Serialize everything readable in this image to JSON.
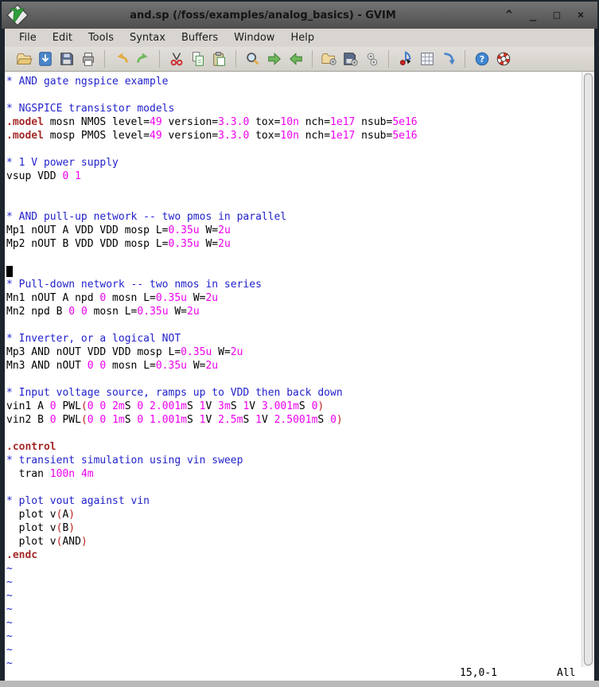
{
  "window": {
    "title": "and.sp (/foss/examples/analog_basics) - GVIM",
    "controls": [
      {
        "name": "shade",
        "glyph": "^"
      },
      {
        "name": "minimize",
        "glyph": "_"
      },
      {
        "name": "maximize",
        "glyph": "□"
      },
      {
        "name": "close",
        "glyph": "×"
      }
    ]
  },
  "menubar": {
    "items": [
      "File",
      "Edit",
      "Tools",
      "Syntax",
      "Buffers",
      "Window",
      "Help"
    ]
  },
  "toolbar": {
    "groups": [
      [
        "open-file",
        "save-file",
        "save-all",
        "print"
      ],
      [
        "undo",
        "redo"
      ],
      [
        "cut",
        "copy",
        "paste"
      ],
      [
        "find-replace",
        "find-next",
        "find-prev"
      ],
      [
        "load-session",
        "save-session",
        "run-script"
      ],
      [
        "make",
        "build-tags",
        "tag-jump"
      ],
      [
        "help",
        "find-in-help"
      ]
    ]
  },
  "colors": {
    "comment": "#2222cc",
    "statement": "#a52a2a",
    "number": "#ee00ee",
    "paren": "#c22121",
    "background": "#ffffff",
    "frame": "#1c242c"
  },
  "editor": {
    "cursor_line": 15,
    "tilde_count": 8,
    "ruler": "15,0-1",
    "scroll_pos": "All",
    "lines": [
      [
        [
          "c",
          "* AND gate ngspice example"
        ]
      ],
      [],
      [
        [
          "c",
          "* NGSPICE transistor models"
        ]
      ],
      [
        [
          "k",
          ".model"
        ],
        [
          "t",
          " mosn NMOS level="
        ],
        [
          "n",
          "49"
        ],
        [
          "t",
          " version="
        ],
        [
          "n",
          "3.3.0"
        ],
        [
          "t",
          " tox="
        ],
        [
          "n",
          "10n"
        ],
        [
          "t",
          " nch="
        ],
        [
          "n",
          "1e17"
        ],
        [
          "t",
          " nsub="
        ],
        [
          "n",
          "5e16"
        ]
      ],
      [
        [
          "k",
          ".model"
        ],
        [
          "t",
          " mosp PMOS level="
        ],
        [
          "n",
          "49"
        ],
        [
          "t",
          " version="
        ],
        [
          "n",
          "3.3.0"
        ],
        [
          "t",
          " tox="
        ],
        [
          "n",
          "10n"
        ],
        [
          "t",
          " nch="
        ],
        [
          "n",
          "1e17"
        ],
        [
          "t",
          " nsub="
        ],
        [
          "n",
          "5e16"
        ]
      ],
      [],
      [
        [
          "c",
          "* 1 V power supply"
        ]
      ],
      [
        [
          "t",
          "vsup VDD "
        ],
        [
          "n",
          "0"
        ],
        [
          "t",
          " "
        ],
        [
          "n",
          "1"
        ]
      ],
      [],
      [],
      [
        [
          "c",
          "* AND pull-up network -- two pmos in parallel"
        ]
      ],
      [
        [
          "t",
          "Mp1 nOUT A VDD VDD mosp L="
        ],
        [
          "n",
          "0.35u"
        ],
        [
          "t",
          " W="
        ],
        [
          "n",
          "2u"
        ]
      ],
      [
        [
          "t",
          "Mp2 nOUT B VDD VDD mosp L="
        ],
        [
          "n",
          "0.35u"
        ],
        [
          "t",
          " W="
        ],
        [
          "n",
          "2u"
        ]
      ],
      [],
      [],
      [
        [
          "c",
          "* Pull-down network -- two nmos in series"
        ]
      ],
      [
        [
          "t",
          "Mn1 nOUT A npd "
        ],
        [
          "n",
          "0"
        ],
        [
          "t",
          " mosn L="
        ],
        [
          "n",
          "0.35u"
        ],
        [
          "t",
          " W="
        ],
        [
          "n",
          "2u"
        ]
      ],
      [
        [
          "t",
          "Mn2 npd B "
        ],
        [
          "n",
          "0"
        ],
        [
          "t",
          " "
        ],
        [
          "n",
          "0"
        ],
        [
          "t",
          " mosn L="
        ],
        [
          "n",
          "0.35u"
        ],
        [
          "t",
          " W="
        ],
        [
          "n",
          "2u"
        ]
      ],
      [],
      [
        [
          "c",
          "* Inverter, or a logical NOT"
        ]
      ],
      [
        [
          "t",
          "Mp3 AND nOUT VDD VDD mosp L="
        ],
        [
          "n",
          "0.35u"
        ],
        [
          "t",
          " W="
        ],
        [
          "n",
          "2u"
        ]
      ],
      [
        [
          "t",
          "Mn3 AND nOUT "
        ],
        [
          "n",
          "0"
        ],
        [
          "t",
          " "
        ],
        [
          "n",
          "0"
        ],
        [
          "t",
          " mosn L="
        ],
        [
          "n",
          "0.35u"
        ],
        [
          "t",
          " W="
        ],
        [
          "n",
          "2u"
        ]
      ],
      [],
      [
        [
          "c",
          "* Input voltage source, ramps up to VDD then back down"
        ]
      ],
      [
        [
          "t",
          "vin1 A "
        ],
        [
          "n",
          "0"
        ],
        [
          "t",
          " PWL"
        ],
        [
          "p",
          "("
        ],
        [
          "n",
          "0"
        ],
        [
          "t",
          " "
        ],
        [
          "n",
          "0"
        ],
        [
          "t",
          " "
        ],
        [
          "n",
          "2m"
        ],
        [
          "t",
          "S "
        ],
        [
          "n",
          "0"
        ],
        [
          "t",
          " "
        ],
        [
          "n",
          "2.001m"
        ],
        [
          "t",
          "S "
        ],
        [
          "n",
          "1"
        ],
        [
          "t",
          "V "
        ],
        [
          "n",
          "3m"
        ],
        [
          "t",
          "S "
        ],
        [
          "n",
          "1"
        ],
        [
          "t",
          "V "
        ],
        [
          "n",
          "3.001m"
        ],
        [
          "t",
          "S "
        ],
        [
          "n",
          "0"
        ],
        [
          "p",
          ")"
        ]
      ],
      [
        [
          "t",
          "vin2 B "
        ],
        [
          "n",
          "0"
        ],
        [
          "t",
          " PWL"
        ],
        [
          "p",
          "("
        ],
        [
          "n",
          "0"
        ],
        [
          "t",
          " "
        ],
        [
          "n",
          "0"
        ],
        [
          "t",
          " "
        ],
        [
          "n",
          "1m"
        ],
        [
          "t",
          "S "
        ],
        [
          "n",
          "0"
        ],
        [
          "t",
          " "
        ],
        [
          "n",
          "1.001m"
        ],
        [
          "t",
          "S "
        ],
        [
          "n",
          "1"
        ],
        [
          "t",
          "V "
        ],
        [
          "n",
          "2.5m"
        ],
        [
          "t",
          "S "
        ],
        [
          "n",
          "1"
        ],
        [
          "t",
          "V "
        ],
        [
          "n",
          "2.5001m"
        ],
        [
          "t",
          "S "
        ],
        [
          "n",
          "0"
        ],
        [
          "p",
          ")"
        ]
      ],
      [],
      [
        [
          "k",
          ".control"
        ]
      ],
      [
        [
          "c",
          "* transient simulation using vin sweep"
        ]
      ],
      [
        [
          "t",
          "  tran "
        ],
        [
          "n",
          "100n"
        ],
        [
          "t",
          " "
        ],
        [
          "n",
          "4m"
        ]
      ],
      [],
      [
        [
          "c",
          "* plot vout against vin"
        ]
      ],
      [
        [
          "t",
          "  plot v"
        ],
        [
          "p",
          "("
        ],
        [
          "t",
          "A"
        ],
        [
          "p",
          ")"
        ]
      ],
      [
        [
          "t",
          "  plot v"
        ],
        [
          "p",
          "("
        ],
        [
          "t",
          "B"
        ],
        [
          "p",
          ")"
        ]
      ],
      [
        [
          "t",
          "  plot v"
        ],
        [
          "p",
          "("
        ],
        [
          "t",
          "AND"
        ],
        [
          "p",
          ")"
        ]
      ],
      [
        [
          "k",
          ".endc"
        ]
      ]
    ]
  }
}
